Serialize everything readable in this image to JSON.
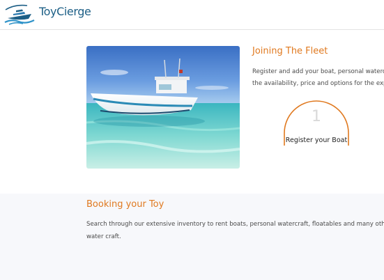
{
  "header": {
    "brand": "ToyCierge"
  },
  "join": {
    "title": "Joining The Fleet",
    "text_line1": "Register and add your boat, personal watercr",
    "text_line2": "the availability, price and options for the expe"
  },
  "step": {
    "number": "1",
    "label": "Register your Boat"
  },
  "booking": {
    "title": "Booking your Toy",
    "text_line1": "Search through our extensive inventory to rent boats, personal watercraft, floatables and many other la",
    "text_line2": "water craft."
  },
  "colors": {
    "accent": "#e0791f",
    "brand": "#1d5f86",
    "body_text": "#4a4a4a",
    "band": "#f7f8fb"
  }
}
